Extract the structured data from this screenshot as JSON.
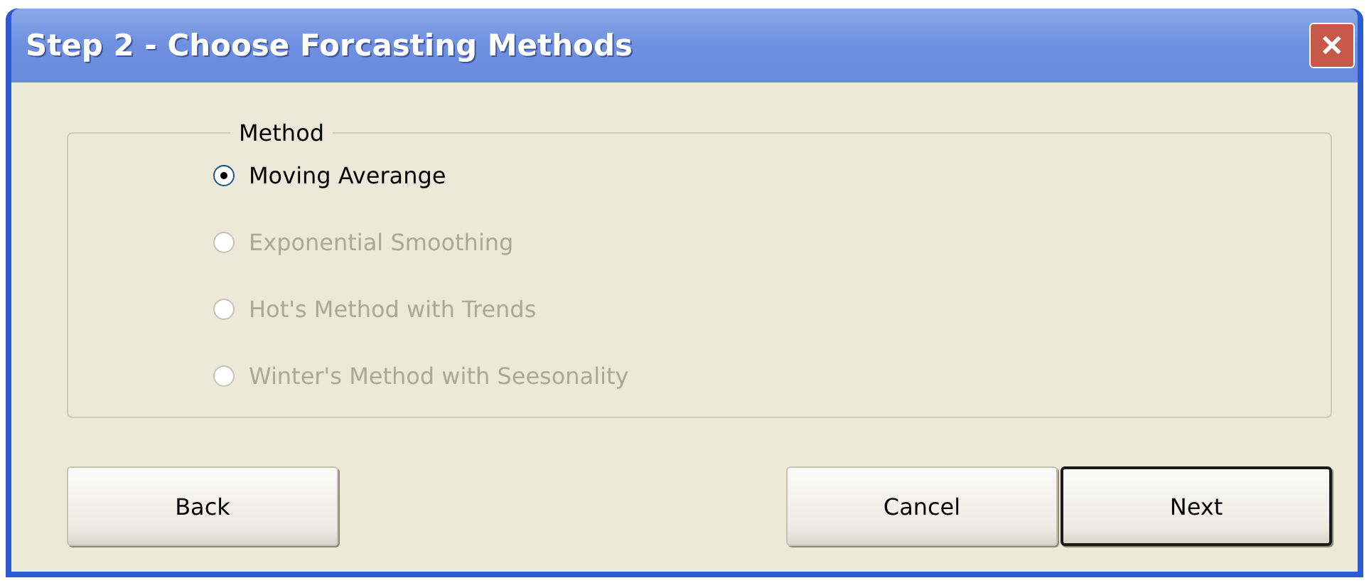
{
  "window": {
    "title": "Step 2 - Choose Forcasting Methods",
    "close": "✕"
  },
  "group": {
    "label": "Method",
    "options": [
      {
        "label": "Moving Averange",
        "selected": true,
        "disabled": false
      },
      {
        "label": "Exponential Smoothing",
        "selected": false,
        "disabled": true
      },
      {
        "label": "Hot's Method with Trends",
        "selected": false,
        "disabled": true
      },
      {
        "label": "Winter's Method with Seesonality",
        "selected": false,
        "disabled": true
      }
    ]
  },
  "buttons": [
    {
      "label": "Back",
      "default": false
    },
    {
      "label": "Cancel",
      "default": false
    },
    {
      "label": "Next",
      "default": true
    }
  ]
}
